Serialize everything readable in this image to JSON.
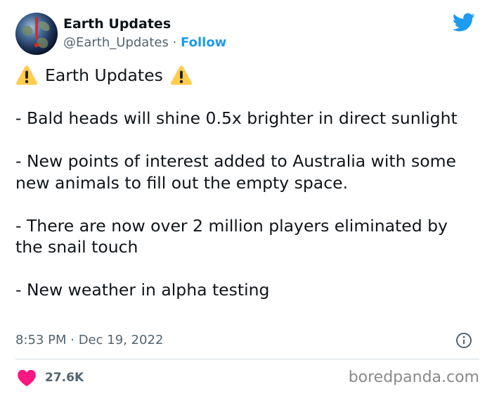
{
  "tweet": {
    "author": {
      "display_name": "Earth Updates",
      "handle": "@Earth_Updates",
      "separator": "·",
      "follow_label": "Follow",
      "avatar_icon": "earth-globe-warning-icon"
    },
    "title_text": "Earth Updates",
    "title_icon": "warning-icon",
    "paragraphs": [
      "- Bald heads will shine 0.5x brighter in direct sunlight",
      "- New points of interest added to Australia with some new animals to fill out the empty space.",
      "- There are now over 2 million players eliminated by the snail touch",
      "- New weather in alpha testing"
    ],
    "timestamp": "8:53 PM · Dec 19, 2022",
    "likes": "27.6K",
    "like_icon": "heart-icon",
    "info_icon": "info-icon",
    "platform_icon": "twitter-bird-icon",
    "watermark": "boredpanda.com",
    "colors": {
      "accent": "#1d9bf0",
      "like": "#f91880",
      "text": "#0f1419",
      "secondary": "#536471",
      "warning": "#ffcc4d"
    }
  }
}
